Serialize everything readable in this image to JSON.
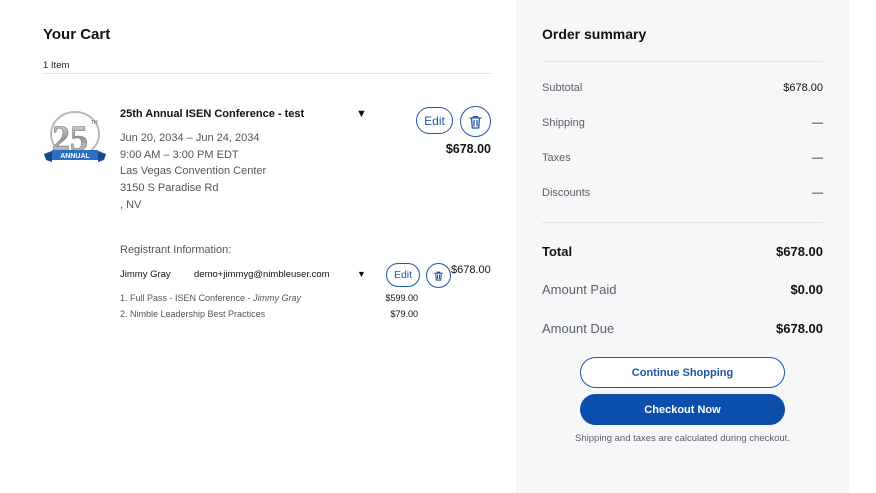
{
  "cart": {
    "title": "Your Cart",
    "item_count": "1 Item",
    "item": {
      "logo_text": "ANNUAL",
      "logo_number": "25",
      "logo_suffix": "TH",
      "name": "25th Annual ISEN Conference - test",
      "dates": "Jun 20, 2034 – Jun 24, 2034",
      "times": "9:00 AM – 3:00 PM EDT",
      "venue": "Las Vegas Convention Center",
      "street": "3150 S Paradise Rd",
      "city_state": ", NV",
      "edit_label": "Edit",
      "price": "$678.00"
    },
    "registrant": {
      "section_label": "Registrant Information:",
      "name": "Jimmy Gray",
      "email": "demo+jimmyg@nimbleuser.com",
      "edit_label": "Edit",
      "price": "$678.00",
      "lines": [
        {
          "prefix": "1. Full Pass - ISEN Conference - ",
          "attendee": "Jimmy Gray",
          "price": "$599.00"
        },
        {
          "prefix": "2. Nimble Leadership Best Practices",
          "attendee": "",
          "price": "$79.00"
        }
      ]
    }
  },
  "summary": {
    "title": "Order summary",
    "subtotal_label": "Subtotal",
    "subtotal_value": "$678.00",
    "shipping_label": "Shipping",
    "shipping_value": "—",
    "taxes_label": "Taxes",
    "taxes_value": "—",
    "discounts_label": "Discounts",
    "discounts_value": "—",
    "total_label": "Total",
    "total_value": "$678.00",
    "paid_label": "Amount Paid",
    "paid_value": "$0.00",
    "due_label": "Amount Due",
    "due_value": "$678.00",
    "continue_label": "Continue Shopping",
    "checkout_label": "Checkout Now",
    "note": "Shipping and taxes are calculated during checkout."
  },
  "colors": {
    "accent": "#1f56a8",
    "primary_button": "#0b4faa",
    "summary_bg": "#f6f7f9"
  }
}
